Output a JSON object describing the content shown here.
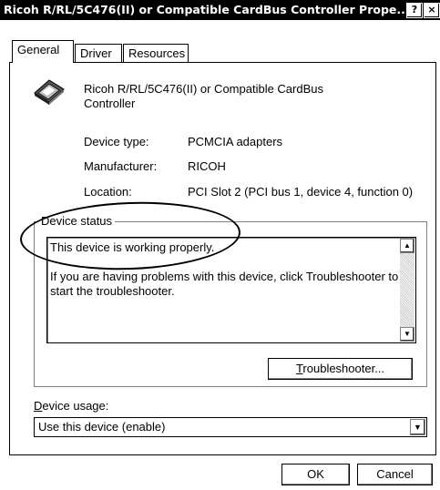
{
  "window": {
    "title": "Ricoh R/RL/5C476(II) or Compatible CardBus Controller Prope...",
    "help_button": "?",
    "close_button": "×"
  },
  "tabs": [
    {
      "label": "General",
      "active": true
    },
    {
      "label": "Driver",
      "active": false
    },
    {
      "label": "Resources",
      "active": false
    }
  ],
  "device": {
    "icon": "cardbus-controller-icon",
    "name_line1": "Ricoh R/RL/5C476(II) or Compatible CardBus",
    "name_line2": "Controller"
  },
  "properties": [
    {
      "label": "Device type:",
      "value": "PCMCIA adapters"
    },
    {
      "label": "Manufacturer:",
      "value": "RICOH"
    },
    {
      "label": "Location:",
      "value": "PCI Slot 2 (PCI bus 1, device 4, function 0)"
    }
  ],
  "device_status": {
    "group_title": "Device status",
    "line1": "This device is working properly.",
    "line2": "If you are having problems with this device, click Troubleshooter to",
    "line3": "start the troubleshooter.",
    "troubleshooter_accesskey": "T",
    "troubleshooter_rest": "roubleshooter..."
  },
  "device_usage": {
    "label_accesskey": "D",
    "label_rest": "evice usage:",
    "selected": "Use this device (enable)"
  },
  "buttons": {
    "ok": "OK",
    "cancel": "Cancel"
  }
}
